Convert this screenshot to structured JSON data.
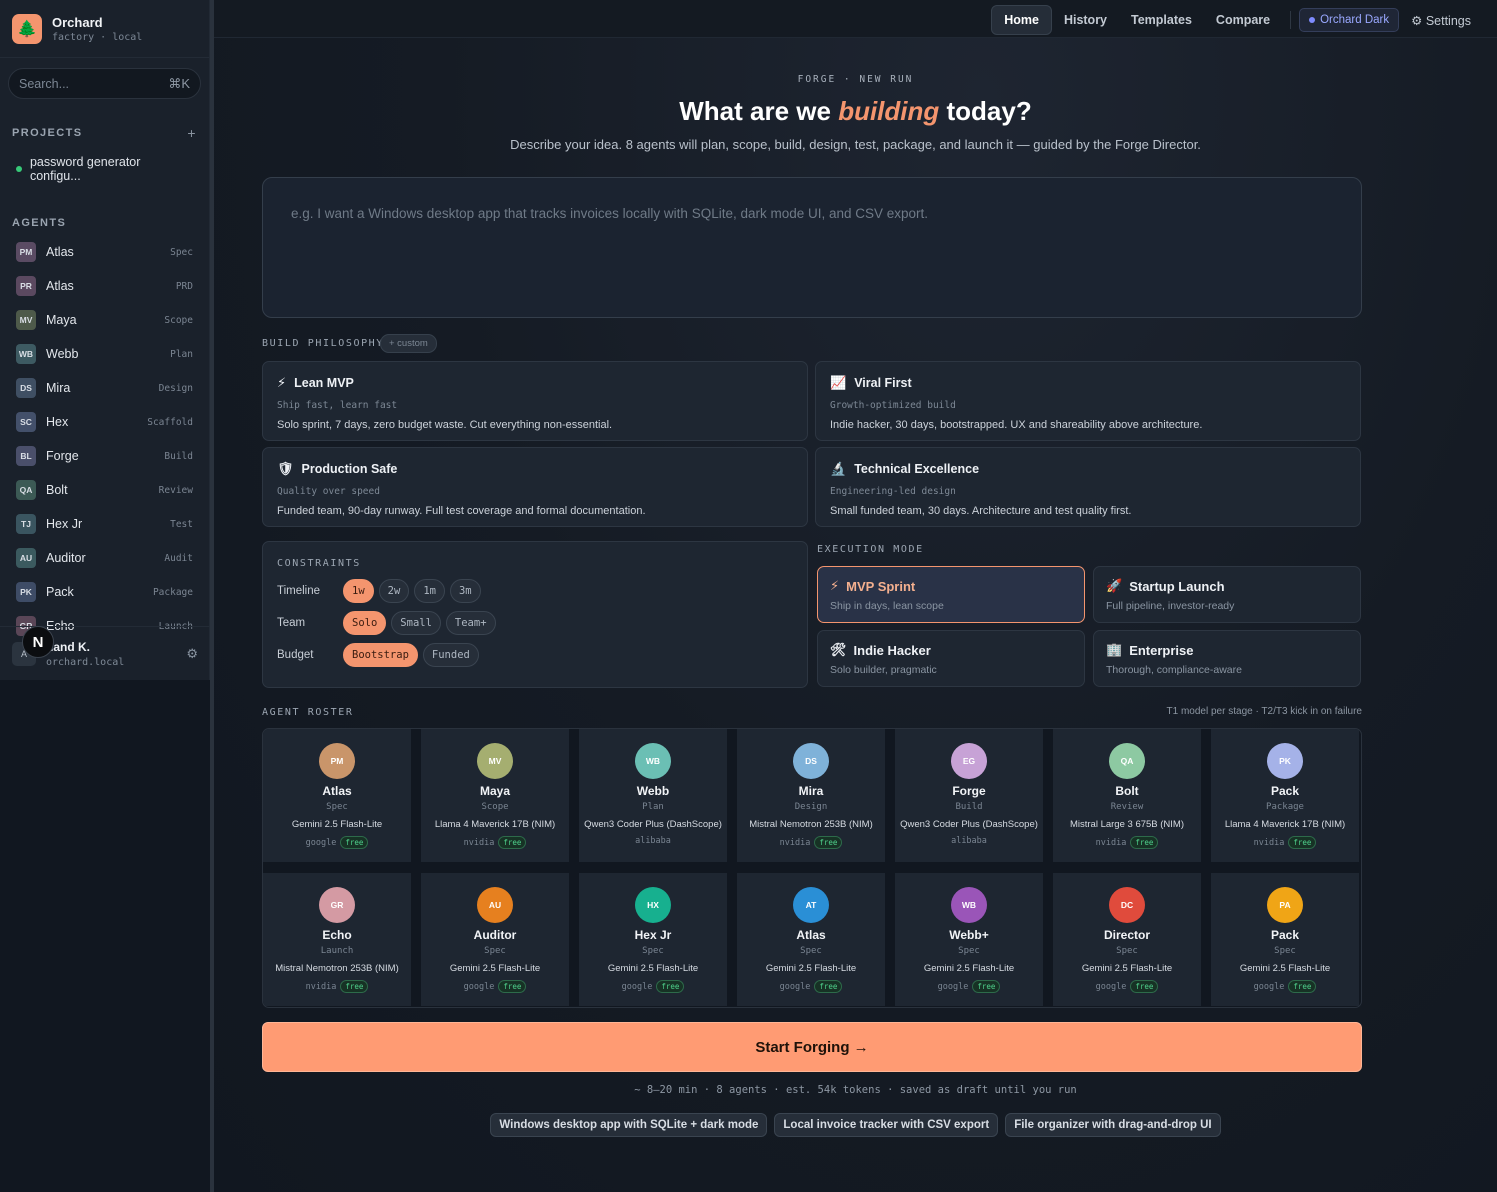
{
  "brand": {
    "name": "Orchard",
    "sub": "factory · local",
    "logo_icon": "tree-icon"
  },
  "search": {
    "placeholder": "Search...",
    "shortcut": "⌘K"
  },
  "projects": {
    "heading": "PROJECTS",
    "add": "+",
    "items": [
      {
        "label": "password generator configu..."
      }
    ]
  },
  "agents": {
    "heading": "AGENTS",
    "items": [
      {
        "badge": "PM",
        "name": "Atlas",
        "role": "Spec",
        "color": "#5a4b63"
      },
      {
        "badge": "PR",
        "name": "Atlas",
        "role": "PRD",
        "color": "#5b4960"
      },
      {
        "badge": "MV",
        "name": "Maya",
        "role": "Scope",
        "color": "#4e5a4a"
      },
      {
        "badge": "WB",
        "name": "Webb",
        "role": "Plan",
        "color": "#3d5a62"
      },
      {
        "badge": "DS",
        "name": "Mira",
        "role": "Design",
        "color": "#3f4f63"
      },
      {
        "badge": "SC",
        "name": "Hex",
        "role": "Scaffold",
        "color": "#43506a"
      },
      {
        "badge": "BL",
        "name": "Forge",
        "role": "Build",
        "color": "#4a4f6a"
      },
      {
        "badge": "QA",
        "name": "Bolt",
        "role": "Review",
        "color": "#3c5a55"
      },
      {
        "badge": "TJ",
        "name": "Hex Jr",
        "role": "Test",
        "color": "#3a5560"
      },
      {
        "badge": "AU",
        "name": "Auditor",
        "role": "Audit",
        "color": "#3b5a5f"
      },
      {
        "badge": "PK",
        "name": "Pack",
        "role": "Package",
        "color": "#3e4c66"
      },
      {
        "badge": "GR",
        "name": "Echo",
        "role": "Launch",
        "color": "#5a4657"
      }
    ]
  },
  "user": {
    "initial": "A",
    "name": "nand K.",
    "host": "orchard.local",
    "overlay": "N"
  },
  "nav": {
    "items": [
      "Home",
      "History",
      "Templates",
      "Compare"
    ],
    "theme": "Orchard Dark",
    "settings": "⚙ Settings"
  },
  "hero": {
    "eyebrow": "FORGE · NEW RUN",
    "title_before": "What are we ",
    "title_em": "building",
    "title_after": " today?",
    "lede": "Describe your idea. 8 agents will plan, scope, build, design, test, package, and launch it — guided by the Forge Director."
  },
  "idea": {
    "placeholder": "e.g. I want a Windows desktop app that tracks invoices locally with SQLite, dark mode UI, and CSV export."
  },
  "philosophy": {
    "heading": "BUILD PHILOSOPHY",
    "custom": "+ custom",
    "cards": [
      {
        "icon": "⚡",
        "title": "Lean MVP",
        "sub": "Ship fast, learn fast",
        "desc": "Solo sprint, 7 days, zero budget waste. Cut everything non-essential."
      },
      {
        "icon": "📈",
        "title": "Viral First",
        "sub": "Growth-optimized build",
        "desc": "Indie hacker, 30 days, bootstrapped. UX and shareability above architecture."
      },
      {
        "icon": "🛡",
        "title": "Production Safe",
        "sub": "Quality over speed",
        "desc": "Funded team, 90-day runway. Full test coverage and formal documentation."
      },
      {
        "icon": "🔬",
        "title": "Technical Excellence",
        "sub": "Engineering-led design",
        "desc": "Small funded team, 30 days. Architecture and test quality first."
      }
    ]
  },
  "constraints": {
    "heading": "CONSTRAINTS",
    "timeline": {
      "label": "Timeline",
      "options": [
        "1w",
        "2w",
        "1m",
        "3m"
      ],
      "selected": 0
    },
    "team": {
      "label": "Team",
      "options": [
        "Solo",
        "Small",
        "Team+"
      ],
      "selected": 0
    },
    "budget": {
      "label": "Budget",
      "options": [
        "Bootstrap",
        "Funded"
      ],
      "selected": 0
    }
  },
  "execution": {
    "heading": "EXECUTION MODE",
    "modes": [
      {
        "icon": "⚡",
        "title": "MVP Sprint",
        "sub": "Ship in days, lean scope",
        "selected": true
      },
      {
        "icon": "🚀",
        "title": "Startup Launch",
        "sub": "Full pipeline, investor-ready",
        "selected": false
      },
      {
        "icon": "🛠",
        "title": "Indie Hacker",
        "sub": "Solo builder, pragmatic",
        "selected": false
      },
      {
        "icon": "🏢",
        "title": "Enterprise",
        "sub": "Thorough, compliance-aware",
        "selected": false
      }
    ]
  },
  "roster": {
    "heading": "AGENT ROSTER",
    "note": "T1 model per stage · T2/T3 kick in on failure",
    "cards": [
      {
        "badge": "PM",
        "name": "Atlas",
        "role": "Spec",
        "model": "Gemini 2.5 Flash-Lite",
        "provider": "google",
        "free": "free",
        "color": "#c9956a"
      },
      {
        "badge": "MV",
        "name": "Maya",
        "role": "Scope",
        "model": "Llama 4 Maverick 17B (NIM)",
        "provider": "nvidia",
        "free": "free",
        "color": "#a5ae70"
      },
      {
        "badge": "WB",
        "name": "Webb",
        "role": "Plan",
        "model": "Qwen3 Coder Plus (DashScope)",
        "provider": "alibaba",
        "free": "",
        "color": "#6bbfb4"
      },
      {
        "badge": "DS",
        "name": "Mira",
        "role": "Design",
        "model": "Mistral Nemotron 253B (NIM)",
        "provider": "nvidia",
        "free": "free",
        "color": "#7fb2d9"
      },
      {
        "badge": "EG",
        "name": "Forge",
        "role": "Build",
        "model": "Qwen3 Coder Plus (DashScope)",
        "provider": "alibaba",
        "free": "",
        "color": "#c7a2d6"
      },
      {
        "badge": "QA",
        "name": "Bolt",
        "role": "Review",
        "model": "Mistral Large 3 675B (NIM)",
        "provider": "nvidia",
        "free": "free",
        "color": "#8dc9a2"
      },
      {
        "badge": "PK",
        "name": "Pack",
        "role": "Package",
        "model": "Llama 4 Maverick 17B (NIM)",
        "provider": "nvidia",
        "free": "free",
        "color": "#a5b2e8"
      },
      {
        "badge": "GR",
        "name": "Echo",
        "role": "Launch",
        "model": "Mistral Nemotron 253B (NIM)",
        "provider": "nvidia",
        "free": "free",
        "color": "#d49aa3"
      },
      {
        "badge": "AU",
        "name": "Auditor",
        "role": "Spec",
        "model": "Gemini 2.5 Flash-Lite",
        "provider": "google",
        "free": "free",
        "color": "#e6801f"
      },
      {
        "badge": "HX",
        "name": "Hex Jr",
        "role": "Spec",
        "model": "Gemini 2.5 Flash-Lite",
        "provider": "google",
        "free": "free",
        "color": "#17b08f"
      },
      {
        "badge": "AT",
        "name": "Atlas",
        "role": "Spec",
        "model": "Gemini 2.5 Flash-Lite",
        "provider": "google",
        "free": "free",
        "color": "#2a8fd6"
      },
      {
        "badge": "WB",
        "name": "Webb+",
        "role": "Spec",
        "model": "Gemini 2.5 Flash-Lite",
        "provider": "google",
        "free": "free",
        "color": "#9a55b8"
      },
      {
        "badge": "DC",
        "name": "Director",
        "role": "Spec",
        "model": "Gemini 2.5 Flash-Lite",
        "provider": "google",
        "free": "free",
        "color": "#e04b3c"
      },
      {
        "badge": "PA",
        "name": "Pack",
        "role": "Spec",
        "model": "Gemini 2.5 Flash-Lite",
        "provider": "google",
        "free": "free",
        "color": "#f0a516"
      }
    ]
  },
  "cta": {
    "label": "Start Forging →"
  },
  "meta": "~ 8–20 min · 8 agents · est. 54k tokens · saved as draft until you run",
  "suggestions": [
    "Windows desktop app with SQLite + dark mode",
    "Local invoice tracker with CSV export",
    "File organizer with drag-and-drop UI"
  ],
  "colors": {
    "accent": "#f4956e",
    "theme": "#7e8bff",
    "free": "#4fd18c"
  }
}
